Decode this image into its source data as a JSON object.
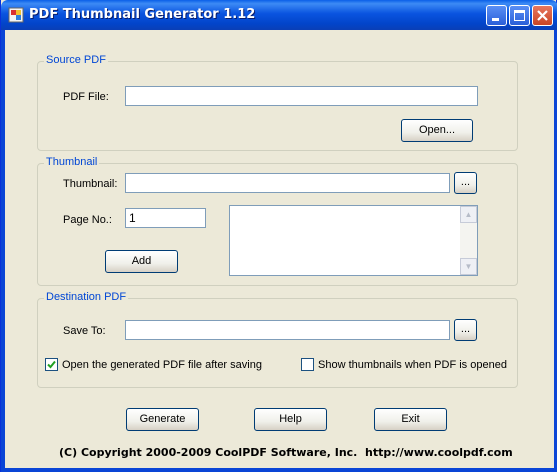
{
  "window": {
    "title": "PDF Thumbnail Generator 1.12"
  },
  "source_pdf": {
    "legend": "Source PDF",
    "pdf_file_label": "PDF File:",
    "pdf_file_value": "",
    "open_button": "Open..."
  },
  "thumbnail": {
    "legend": "Thumbnail",
    "thumbnail_label": "Thumbnail:",
    "thumbnail_value": "",
    "browse_button": "...",
    "page_label": "Page No.:",
    "page_value": "1",
    "add_button": "Add"
  },
  "destination_pdf": {
    "legend": "Destination PDF",
    "save_to_label": "Save To:",
    "save_to_value": "",
    "browse_button": "...",
    "open_after_saving": {
      "label": "Open the generated PDF file after saving",
      "checked": true
    },
    "show_thumbnails": {
      "label": "Show thumbnails when PDF is opened",
      "checked": false
    }
  },
  "actions": {
    "generate": "Generate",
    "help": "Help",
    "exit": "Exit"
  },
  "footer": {
    "copyright": "(C) Copyright 2000-2009 CoolPDF Software, Inc.",
    "url": "http://www.coolpdf.com"
  },
  "colors": {
    "titlebar": "#0a54e0",
    "legend_text": "#0046d5",
    "face": "#ece9d8"
  }
}
